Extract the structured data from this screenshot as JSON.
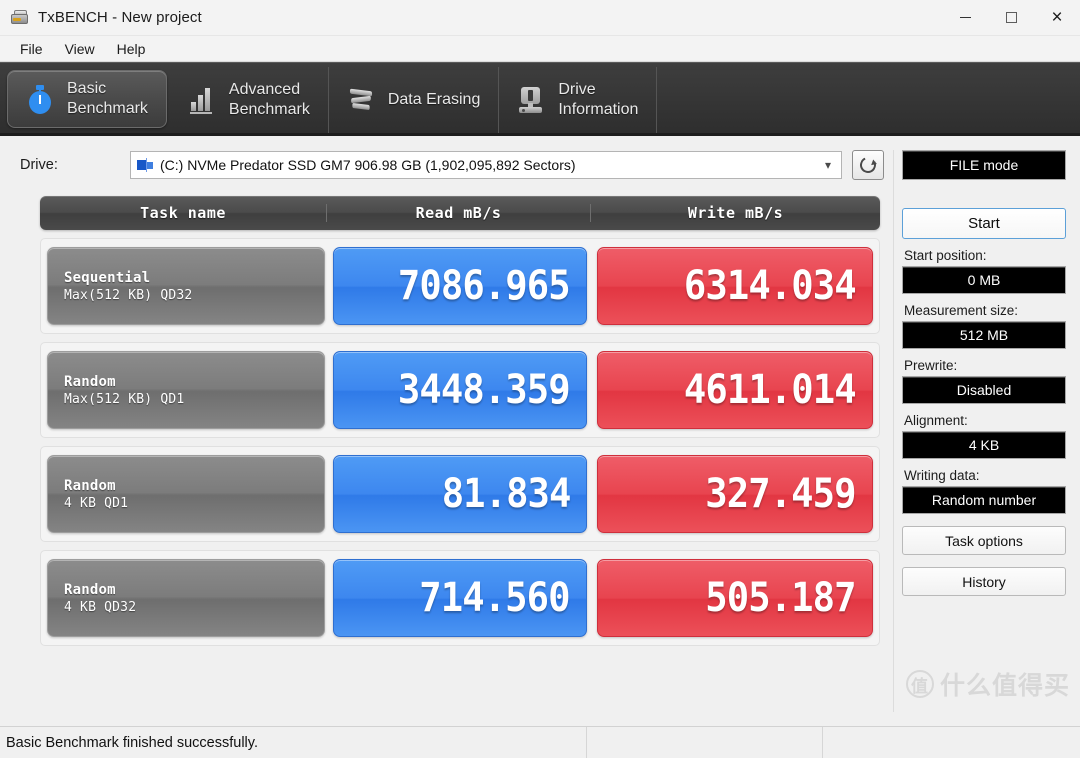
{
  "window": {
    "title": "TxBENCH - New project",
    "app_icon": "drive-icon",
    "minimize_label": "",
    "maximize_label": "",
    "close_label": "×"
  },
  "menu": {
    "items": [
      {
        "label": "File"
      },
      {
        "label": "View"
      },
      {
        "label": "Help"
      }
    ]
  },
  "tabs": [
    {
      "label": "Basic\nBenchmark",
      "icon": "stopwatch-icon",
      "active": true
    },
    {
      "label": "Advanced\nBenchmark",
      "icon": "bar-chart-icon",
      "active": false
    },
    {
      "label": "Data Erasing",
      "icon": "shredder-icon",
      "active": false
    },
    {
      "label": "Drive\nInformation",
      "icon": "drive-info-icon",
      "active": false
    }
  ],
  "drive": {
    "label": "Drive:",
    "selected": "(C:) NVMe Predator SSD GM7  906.98 GB (1,902,095,892 Sectors)",
    "dropdown_icon": "chevron-down-icon",
    "refresh_icon": "refresh-icon"
  },
  "table": {
    "headers": {
      "task": "Task name",
      "read": "Read mB/s",
      "write": "Write mB/s"
    },
    "rows": [
      {
        "task_line1": "Sequential",
        "task_line2": "Max(512 KB) QD32",
        "read": "7086.965",
        "write": "6314.034"
      },
      {
        "task_line1": "Random",
        "task_line2": "Max(512 KB) QD1",
        "read": "3448.359",
        "write": "4611.014"
      },
      {
        "task_line1": "Random",
        "task_line2": "4 KB QD1",
        "read": "81.834",
        "write": "327.459"
      },
      {
        "task_line1": "Random",
        "task_line2": "4 KB QD32",
        "read": "714.560",
        "write": "505.187"
      }
    ]
  },
  "panel": {
    "mode_button": "FILE mode",
    "start_button": "Start",
    "start_position_label": "Start position:",
    "start_position_value": "0 MB",
    "measurement_size_label": "Measurement size:",
    "measurement_size_value": "512 MB",
    "prewrite_label": "Prewrite:",
    "prewrite_value": "Disabled",
    "alignment_label": "Alignment:",
    "alignment_value": "4 KB",
    "writing_data_label": "Writing data:",
    "writing_data_value": "Random number",
    "task_options_button": "Task options",
    "history_button": "History"
  },
  "status": {
    "message": "Basic Benchmark finished successfully.",
    "panel2": "",
    "panel3": ""
  },
  "watermark": {
    "mark": "值",
    "text": "什么值得买"
  },
  "colors": {
    "read_blue": "#3d87ef",
    "write_red": "#e8444f",
    "tab_bar": "#373737",
    "accent_start": "#5ca0d8"
  }
}
